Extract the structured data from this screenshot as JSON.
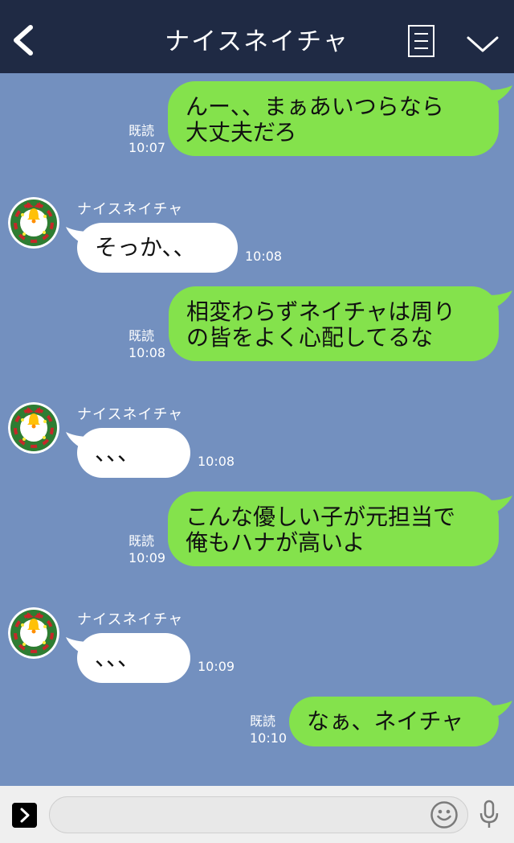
{
  "header": {
    "title": "ナイスネイチャ"
  },
  "messages": [
    {
      "side": "right",
      "lines": [
        "んー、、まぁあいつらなら",
        "大丈夫だろ"
      ],
      "read": "既読",
      "time": "10:07"
    },
    {
      "side": "left",
      "sender": "ナイスネイチャ",
      "text": "そっか、、",
      "time": "10:08"
    },
    {
      "side": "right",
      "lines": [
        "相変わらずネイチャは周り",
        "の皆をよく心配してるな"
      ],
      "read": "既読",
      "time": "10:08"
    },
    {
      "side": "left",
      "sender": "ナイスネイチャ",
      "text": "、、、",
      "time": "10:08"
    },
    {
      "side": "right",
      "lines": [
        "こんな優しい子が元担当で",
        "俺もハナが高いよ"
      ],
      "read": "既読",
      "time": "10:09"
    },
    {
      "side": "left",
      "sender": "ナイスネイチャ",
      "text": "、、、",
      "time": "10:09"
    },
    {
      "side": "right",
      "lines": [
        "なぁ、ネイチャ"
      ],
      "read": "既読",
      "time": "10:10"
    }
  ],
  "footer": {
    "input_value": "",
    "input_placeholder": ""
  },
  "colors": {
    "header_bg": "#1f2a44",
    "chat_bg": "#7390bf",
    "mine_bubble": "#84e24c",
    "their_bubble": "#ffffff"
  },
  "icons": [
    "back-chevron-icon",
    "menu-list-icon",
    "chevron-down-icon",
    "wreath-bell-avatar",
    "expand-arrow-icon",
    "smiley-icon",
    "microphone-icon"
  ]
}
